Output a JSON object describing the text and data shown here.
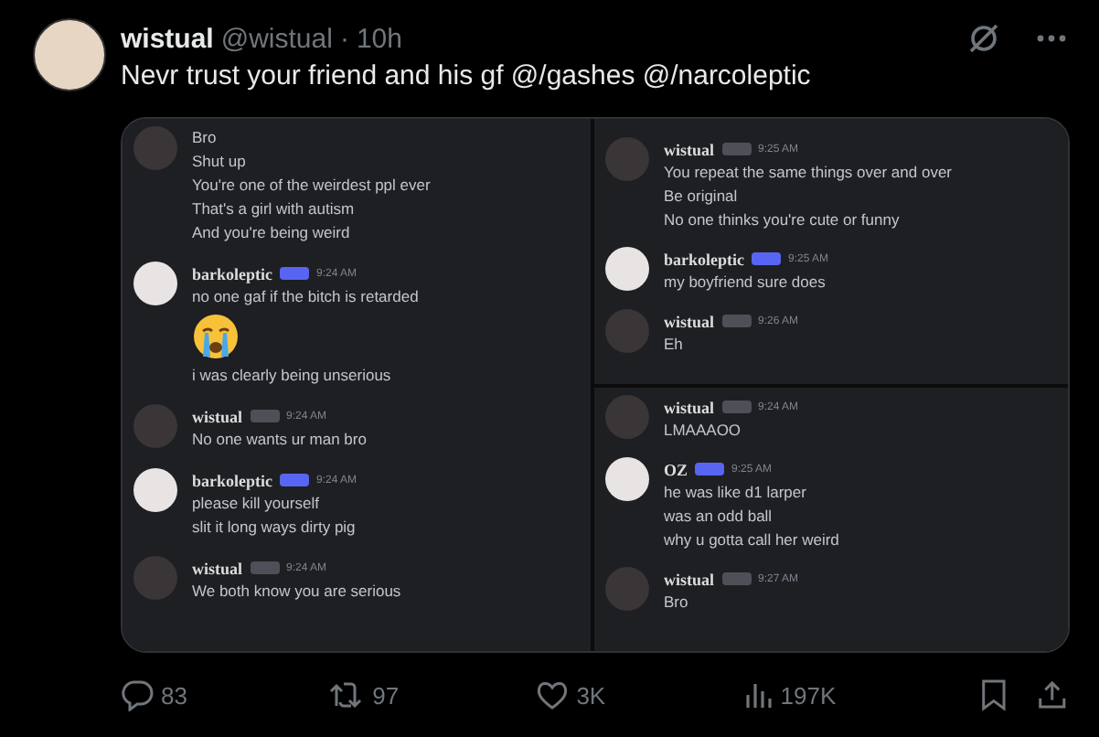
{
  "tweet": {
    "author": {
      "name": "wistual",
      "handle": "@wistual",
      "separator": "·",
      "time": "10h"
    },
    "text": "Nevr trust your friend and his gf @/gashes @/narcoleptic",
    "media": {
      "panels": [
        {
          "groups": [
            {
              "avatar": {
                "color": "#3a3536"
              },
              "lines": [
                {
                  "kind": "text",
                  "text": "Bro"
                },
                {
                  "kind": "text",
                  "text": "Shut up"
                },
                {
                  "kind": "text",
                  "text": "You're one of the weirdest ppl ever"
                },
                {
                  "kind": "text",
                  "text": "That's a girl with autism"
                },
                {
                  "kind": "text",
                  "text": "And you're being weird"
                }
              ]
            },
            {
              "avatar": {
                "color": "#e9e4e4"
              },
              "author": "barkoleptic",
              "badge": {
                "color": "#5865f2"
              },
              "time": "9:24 AM",
              "lines": [
                {
                  "kind": "text",
                  "text": "no one gaf if the bitch is retarded"
                },
                {
                  "kind": "emoji"
                },
                {
                  "kind": "text",
                  "text": "i was clearly being unserious"
                }
              ]
            },
            {
              "avatar": {
                "color": "#3a3536"
              },
              "author": "wistual",
              "badge": {
                "color": "#4e5058"
              },
              "time": "9:24 AM",
              "lines": [
                {
                  "kind": "text",
                  "text": "No one wants ur man bro"
                }
              ]
            },
            {
              "avatar": {
                "color": "#e9e4e4"
              },
              "author": "barkoleptic",
              "badge": {
                "color": "#5865f2"
              },
              "time": "9:24 AM",
              "lines": [
                {
                  "kind": "text",
                  "text": "please kill yourself"
                },
                {
                  "kind": "text",
                  "text": "slit it long ways dirty pig"
                }
              ]
            },
            {
              "avatar": {
                "color": "#3a3536"
              },
              "author": "wistual",
              "badge": {
                "color": "#4e5058"
              },
              "time": "9:24 AM",
              "lines": [
                {
                  "kind": "text",
                  "text": "We both know you are serious"
                }
              ]
            }
          ]
        },
        {
          "groups": [
            {
              "avatar": {
                "color": "#3a3536"
              },
              "author": "wistual",
              "badge": {
                "color": "#4e5058"
              },
              "time": "9:25 AM",
              "lines": [
                {
                  "kind": "text",
                  "text": "You repeat the same things over and over"
                },
                {
                  "kind": "text",
                  "text": "Be original"
                },
                {
                  "kind": "text",
                  "text": "No one thinks you're cute or funny"
                }
              ]
            },
            {
              "avatar": {
                "color": "#e9e4e4"
              },
              "author": "barkoleptic",
              "badge": {
                "color": "#5865f2"
              },
              "time": "9:25 AM",
              "lines": [
                {
                  "kind": "text",
                  "text": "my boyfriend sure does"
                }
              ]
            },
            {
              "avatar": {
                "color": "#3a3536"
              },
              "author": "wistual",
              "badge": {
                "color": "#4e5058"
              },
              "time": "9:26 AM",
              "lines": [
                {
                  "kind": "text",
                  "text": "Eh"
                }
              ]
            }
          ]
        },
        {
          "groups": [
            {
              "avatar": {
                "color": "#3a3536"
              },
              "author": "wistual",
              "badge": {
                "color": "#4e5058"
              },
              "time": "9:24 AM",
              "lines": [
                {
                  "kind": "text",
                  "text": "LMAAAOO"
                }
              ]
            },
            {
              "avatar": {
                "color": "#e9e4e4"
              },
              "author": "OZ",
              "badge": {
                "color": "#5865f2"
              },
              "time": "9:25 AM",
              "lines": [
                {
                  "kind": "text",
                  "text": "he was like d1 larper"
                },
                {
                  "kind": "text",
                  "text": "was an odd ball"
                },
                {
                  "kind": "text",
                  "text": "why u gotta call her weird"
                }
              ]
            },
            {
              "avatar": {
                "color": "#3a3536"
              },
              "author": "wistual",
              "badge": {
                "color": "#4e5058"
              },
              "time": "9:27 AM",
              "lines": [
                {
                  "kind": "text",
                  "text": "Bro"
                }
              ]
            }
          ]
        }
      ]
    },
    "actions": [
      {
        "kind": "reply",
        "count": "83"
      },
      {
        "kind": "repost",
        "count": "97"
      },
      {
        "kind": "like",
        "count": "3K"
      },
      {
        "kind": "views",
        "count": "197K"
      }
    ]
  }
}
